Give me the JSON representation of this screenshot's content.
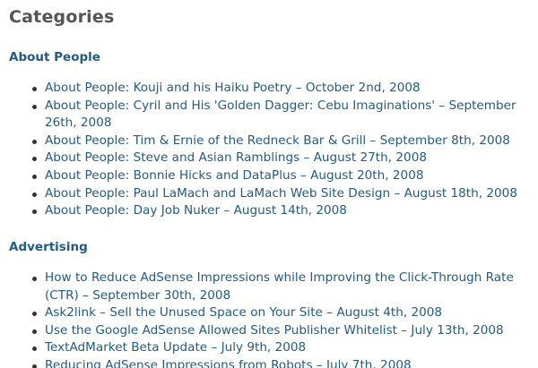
{
  "page": {
    "title": "Categories"
  },
  "sections": [
    {
      "heading": "About People",
      "posts": [
        "About People: Kouji and his Haiku Poetry – October 2nd, 2008",
        "About People: Cyril and His 'Golden Dagger: Cebu Imaginations' – September 26th, 2008",
        "About People: Tim & Ernie of the Redneck Bar & Grill – September 8th, 2008",
        "About People: Steve and Asian Ramblings – August 27th, 2008",
        "About People: Bonnie Hicks and DataPlus – August 20th, 2008",
        "About People: Paul LaMach and LaMach Web Site Design – August 18th, 2008",
        "About People: Day Job Nuker – August 14th, 2008"
      ]
    },
    {
      "heading": "Advertising",
      "posts": [
        "How to Reduce AdSense Impressions while Improving the Click-Through Rate (CTR) – September 30th, 2008",
        "Ask2link – Sell the Unused Space on Your Site – August 4th, 2008",
        "Use the Google AdSense Allowed Sites Publisher Whitelist – July 13th, 2008",
        "TextAdMarket Beta Update – July 9th, 2008",
        "Reducing AdSense Impressions from Robots – July 7th, 2008"
      ]
    }
  ],
  "colors": {
    "link": "#1f5a8d",
    "title": "#555555",
    "bullet": "#333333"
  }
}
